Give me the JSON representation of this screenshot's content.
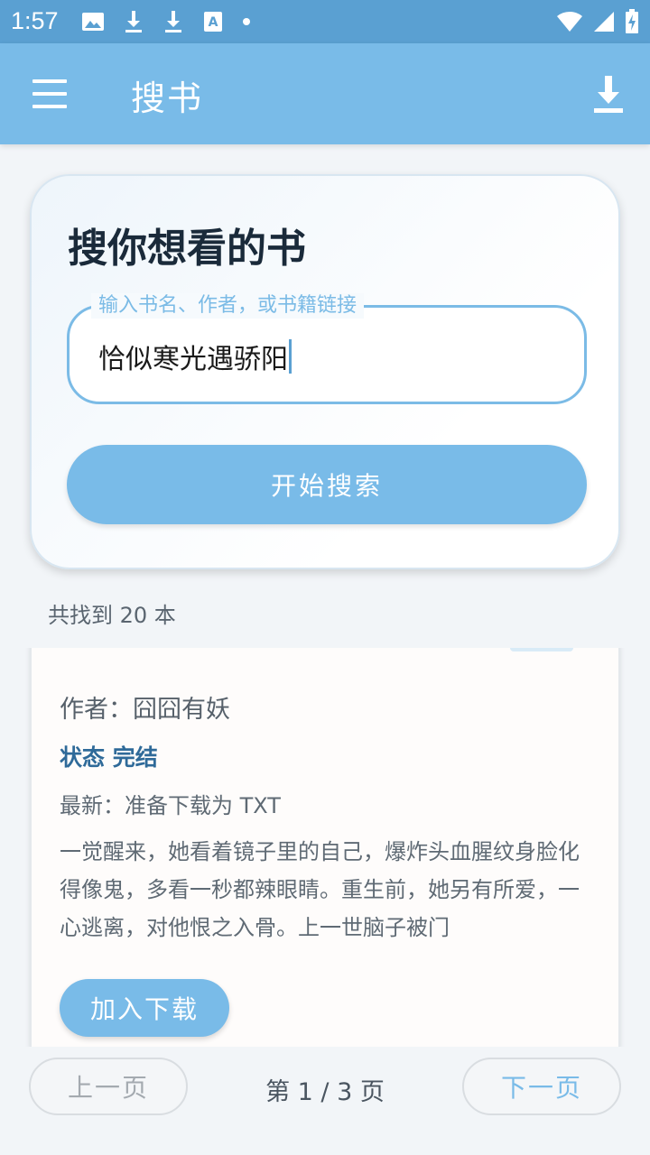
{
  "status_bar": {
    "time": "1:57",
    "left_icons": [
      "image-icon",
      "download-icon",
      "download-icon",
      "font-download-icon",
      "dot-icon"
    ],
    "right_icons": [
      "wifi-icon",
      "signal-icon",
      "battery-charging-icon"
    ]
  },
  "app_bar": {
    "title": "搜书",
    "menu_icon": "menu-icon",
    "action_icon": "download-icon"
  },
  "search": {
    "heading": "搜你想看的书",
    "field_label": "输入书名、作者，或书籍链接",
    "field_value": "恰似寒光遇骄阳",
    "button_label": "开始搜索"
  },
  "results": {
    "count_text": "共找到 20 本",
    "items": [
      {
        "author": "作者：囧囧有妖",
        "status": "状态 完结",
        "latest": "最新：准备下载为 TXT",
        "description": "一觉醒来，她看着镜子里的自己，爆炸头血腥纹身脸化得像鬼，多看一秒都辣眼睛。重生前，她另有所爱，一心逃离，对他恨之入骨。上一世脑子被门",
        "add_button": "加入下载"
      }
    ]
  },
  "pagination": {
    "prev_label": "上一页",
    "page_info": "第 1 / 3 页",
    "next_label": "下一页"
  },
  "colors": {
    "status_bar": "#5aa0d2",
    "app_bar": "#79bbe8",
    "accent": "#79bbe8",
    "status_text": "#2f6a99"
  }
}
